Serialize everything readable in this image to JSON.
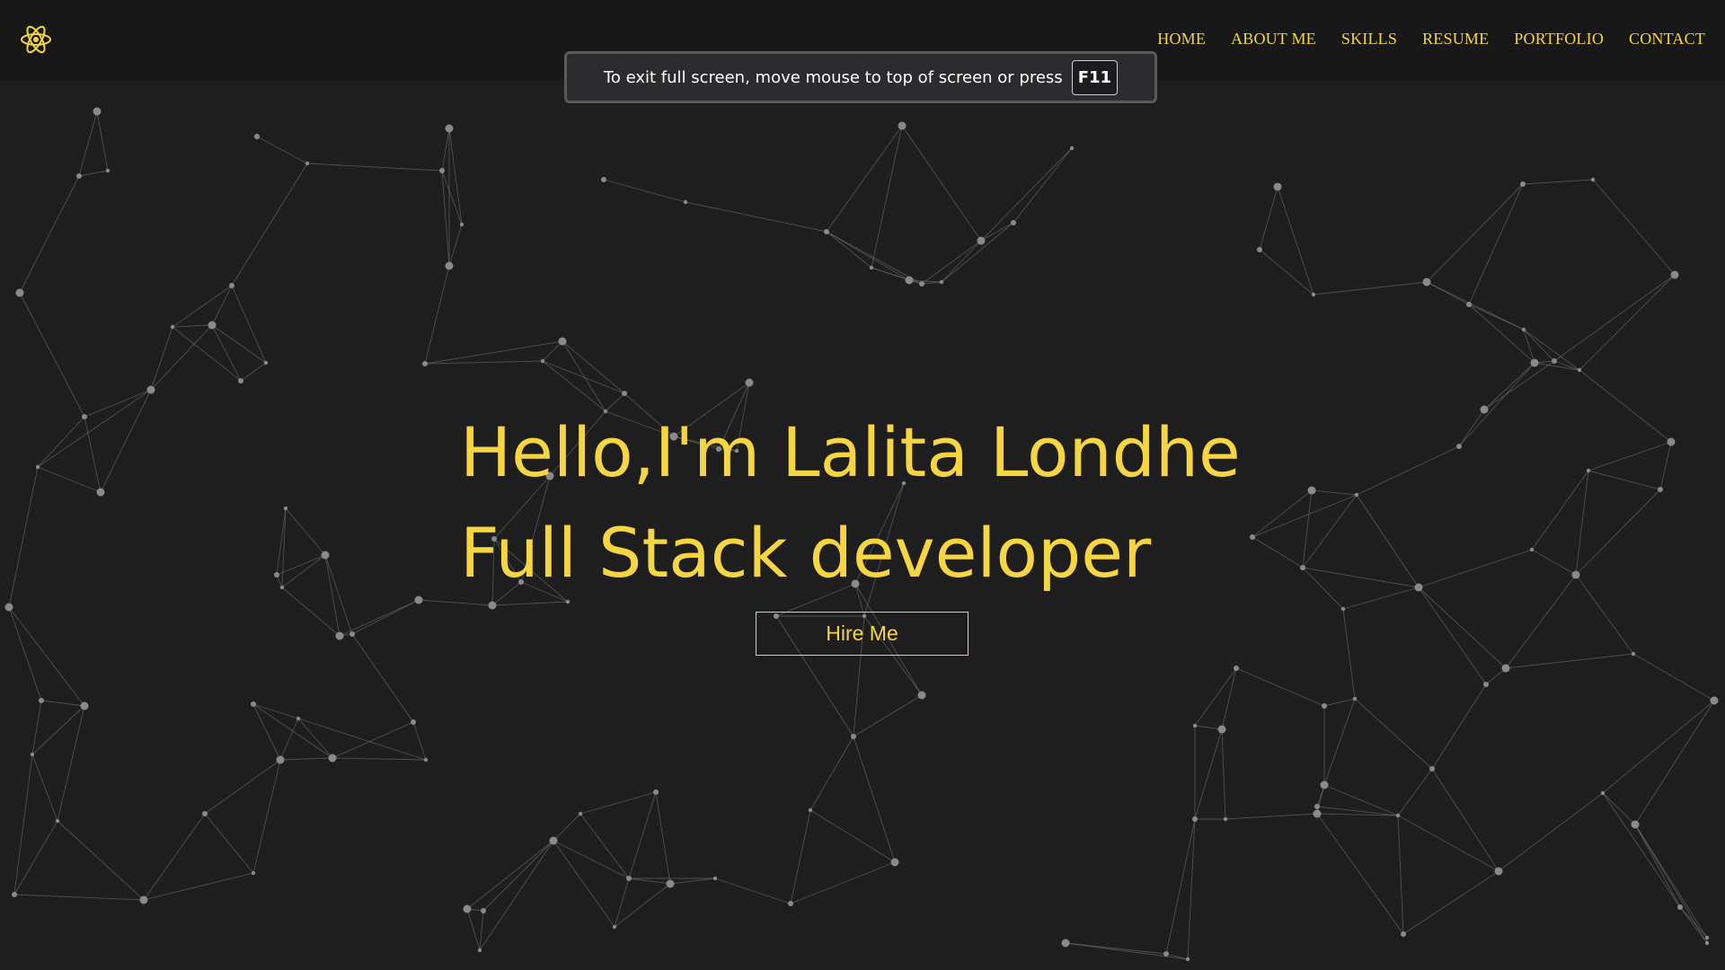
{
  "nav": {
    "logo_icon": "react-atom-icon",
    "links": [
      "HOME",
      "ABOUT ME",
      "SKILLS",
      "RESUME",
      "PORTFOLIO",
      "CONTACT"
    ]
  },
  "fullscreen_notice": {
    "text": "To exit full screen, move mouse to top of screen or press",
    "key": "F11"
  },
  "hero": {
    "line1": "Hello,I'm Lalita Londhe",
    "line2": "Full Stack developer",
    "button_label": "Hire Me"
  },
  "colors": {
    "accent": "#f5d542",
    "background": "#1e1e1e",
    "navbar": "#181818",
    "particle": "#8a8a8a"
  }
}
